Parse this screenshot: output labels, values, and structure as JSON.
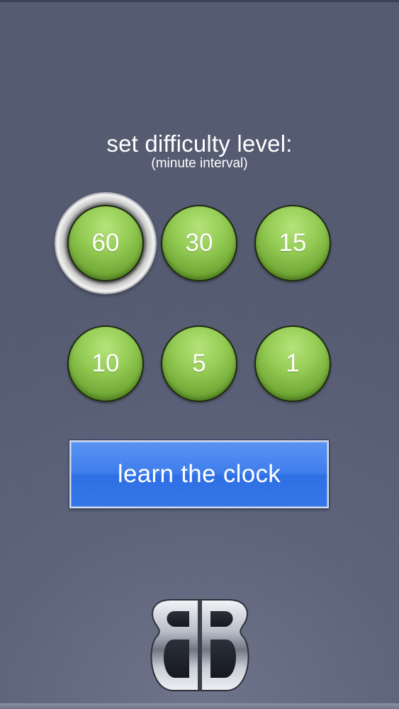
{
  "header": {
    "title": "set difficulty level:",
    "subtitle": "(minute interval)"
  },
  "levels": {
    "items": [
      {
        "label": "60",
        "selected": true
      },
      {
        "label": "30",
        "selected": false
      },
      {
        "label": "15",
        "selected": false
      },
      {
        "label": "10",
        "selected": false
      },
      {
        "label": "5",
        "selected": false
      },
      {
        "label": "1",
        "selected": false
      }
    ]
  },
  "actions": {
    "learn_label": "learn the clock"
  },
  "colors": {
    "background": "#575d73",
    "level_button": "#86c046",
    "learn_button": "#3e7deb"
  },
  "logo": {
    "icon": "bb-logo"
  }
}
